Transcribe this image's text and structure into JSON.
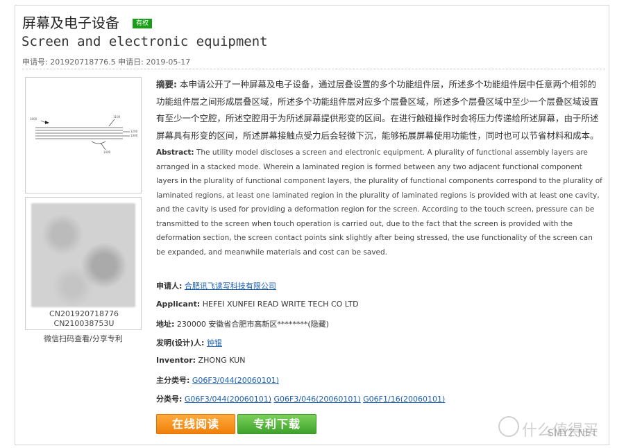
{
  "header": {
    "title_cn": "屏幕及电子设备",
    "badge": "有权",
    "title_en": "Screen and electronic equipment",
    "meta": "申请号: 201920718776.5 申请日: 2019-05-17"
  },
  "figure": {
    "labels": [
      "1000",
      "1100",
      "1200",
      "1300",
      "1400"
    ]
  },
  "qr": {
    "number1": "CN201920718776",
    "number2": "CN210038753U",
    "caption": "微信扫码查看/分享专利"
  },
  "abstract": {
    "cn_label": "摘要:",
    "cn_text": "本申请公开了一种屏幕及电子设备，通过层叠设置的多个功能组件层，所述多个功能组件层中任意两个相邻的功能组件层之间形成层叠区域，所述多个功能组件层对应多个层叠区域，所述多个层叠区域中至少一个层叠区域设置有至少一个空腔，所述空腔用于为所述屏幕提供形变的区间。在进行触碰操作时会将压力传递给所述屏幕，由于所述屏幕具有形变的区间，所述屏幕接触点受力后会轻微下沉，能够拓展屏幕使用功能性，同时也可以节省材料和成本。",
    "en_label": "Abstract:",
    "en_text": "The utility model discloses a screen and electronic equipment. A plurality of functional assembly layers are arranged in a stacked mode. Wherein a laminated region is formed between any two adjacent functional component layers in the plurality of functional component layers, the plurality of functional components correspond to the plurality of laminated regions, at least one laminated region in the plurality of laminated regions is provided with at least one cavity, and the cavity is used for providing a deformation region for the screen. According to the touch screen, pressure can be transmitted to the screen when touch operation is carried out, due to the fact that the screen is provided with the deformation section, the screen contact points sink slightly after being stressed, the use functionality of the screen can be expanded, and meanwhile materials and cost can be saved."
  },
  "fields": {
    "applicant_cn_label": "申请人:",
    "applicant_cn": "合肥讯飞读写科技有限公司",
    "applicant_en_label": "Applicant:",
    "applicant_en": "HEFEI XUNFEI READ WRITE TECH CO LTD",
    "address_label": "地址:",
    "address": "230000 安徽省合肥市高新区********(隐藏)",
    "inventor_cn_label": "发明(设计)人:",
    "inventor_cn": "钟锟",
    "inventor_en_label": "Inventor:",
    "inventor_en": "ZHONG KUN",
    "main_class_label": "主分类号:",
    "main_class": "G06F3/044(20060101)",
    "classes_label": "分类号:",
    "classes": [
      "G06F3/044(20060101)",
      "G06F3/046(20060101)",
      "G06F1/16(20060101)"
    ]
  },
  "buttons": {
    "read": "在线阅读",
    "download": "专利下载"
  },
  "watermark": {
    "cn": "什么值得买",
    "en": "SMYZ.NET"
  }
}
